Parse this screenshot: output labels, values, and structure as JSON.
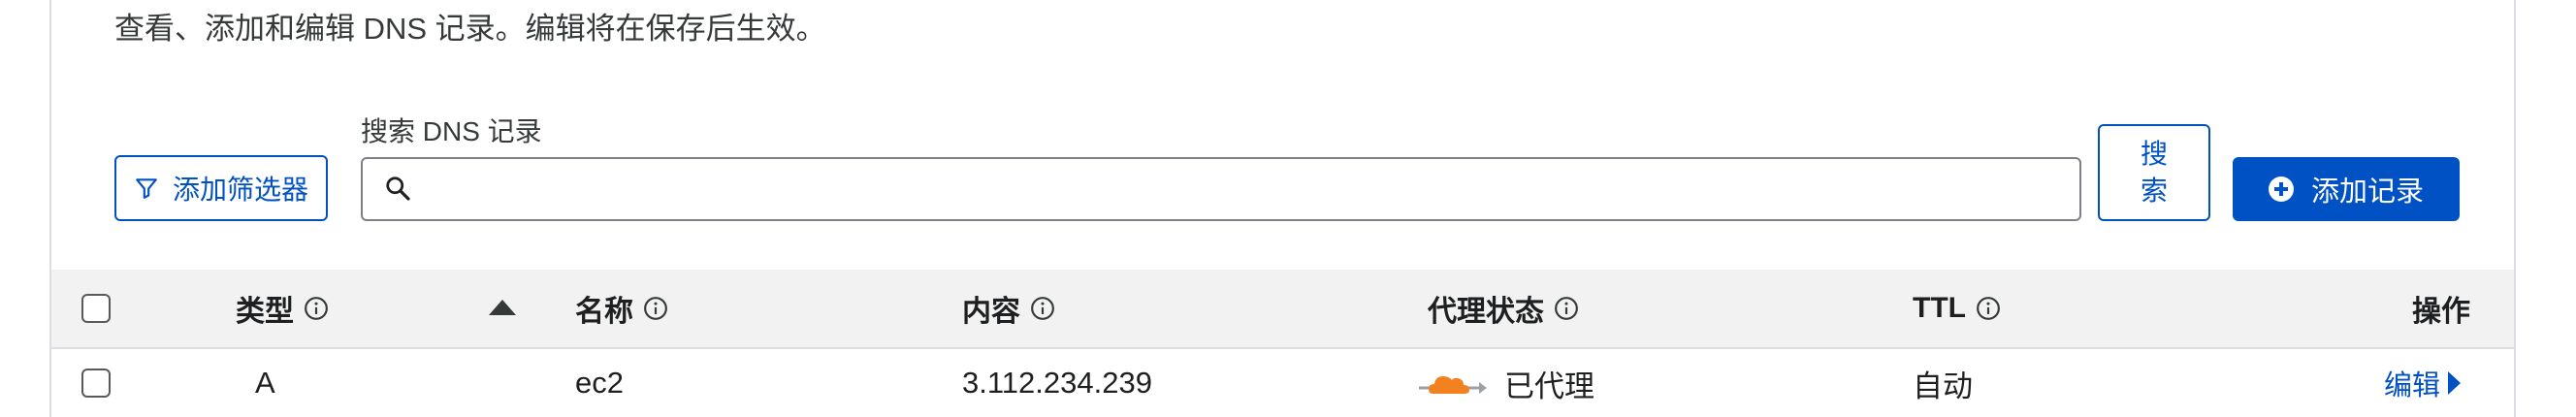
{
  "description": "查看、添加和编辑 DNS 记录。编辑将在保存后生效。",
  "toolbar": {
    "filter_label": "添加筛选器",
    "search_label": "搜索 DNS 记录",
    "search_value": "",
    "search_button": "搜索",
    "add_record_label": "添加记录"
  },
  "table": {
    "headers": {
      "type": "类型",
      "name": "名称",
      "content": "内容",
      "proxy_status": "代理状态",
      "ttl": "TTL",
      "actions": "操作"
    },
    "rows": [
      {
        "type": "A",
        "name": "ec2",
        "content": "3.112.234.239",
        "proxy_status": "已代理",
        "ttl": "自动",
        "action": "编辑"
      }
    ]
  },
  "colors": {
    "accent": "#0051c3",
    "proxy_cloud": "#f48120",
    "header_bg": "#f2f2f2"
  },
  "icons": [
    "filter-icon",
    "search-icon",
    "plus-circle-icon",
    "info-icon",
    "sort-ascending-icon",
    "proxied-cloud-icon",
    "chevron-right-icon"
  ]
}
